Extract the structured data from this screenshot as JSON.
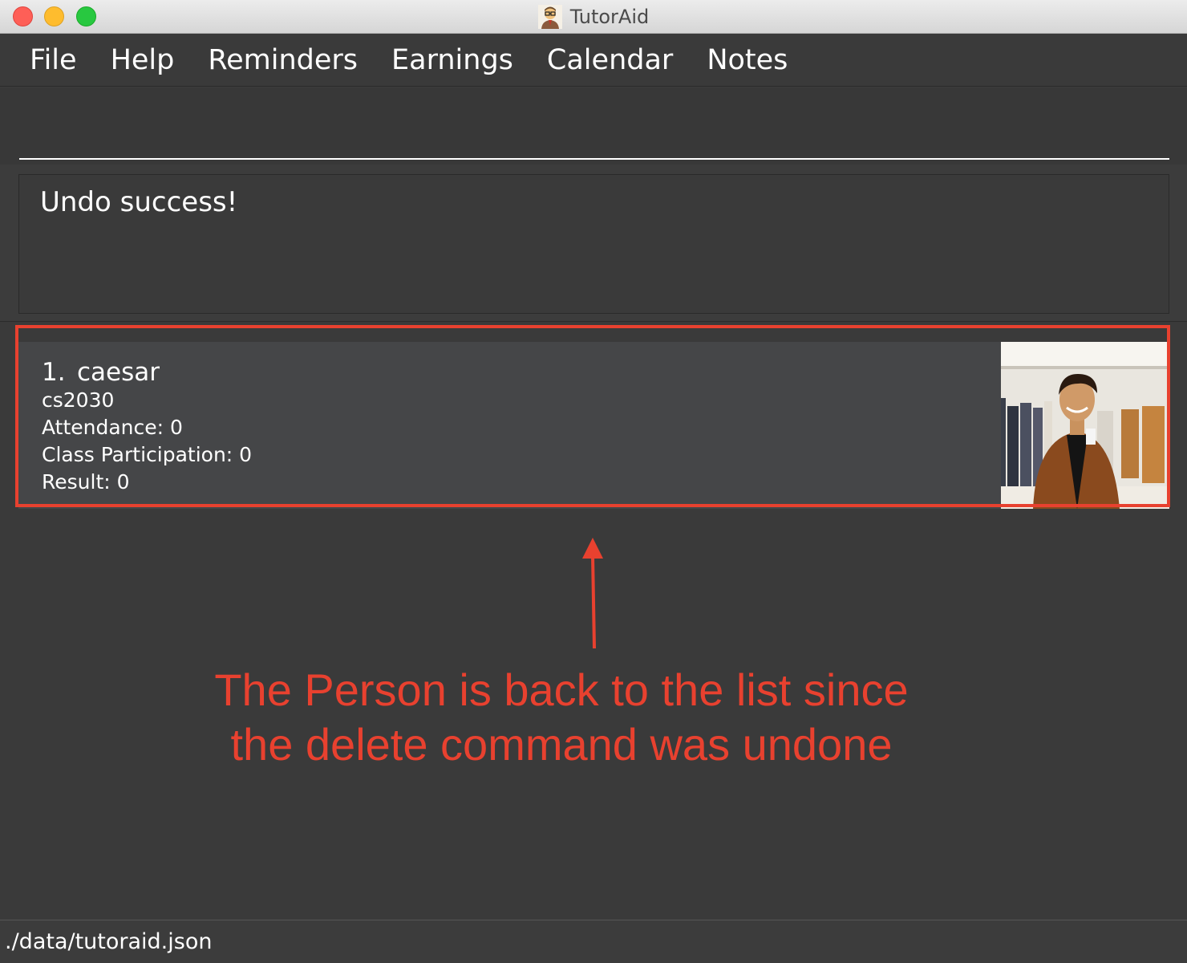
{
  "window": {
    "title": "TutorAid"
  },
  "menu": {
    "items": [
      "File",
      "Help",
      "Reminders",
      "Earnings",
      "Calendar",
      "Notes"
    ]
  },
  "command": {
    "value": ""
  },
  "result": {
    "message": "Undo success!"
  },
  "persons": [
    {
      "index": "1.",
      "name": "caesar",
      "module": "cs2030",
      "attendance": "Attendance: 0",
      "participation": "Class Participation: 0",
      "result": "Result: 0"
    }
  ],
  "annotation": {
    "line1": "The Person is back to the list since",
    "line2": "the delete command was undone",
    "color": "#e8412f"
  },
  "status": {
    "path": "./data/tutoraid.json"
  },
  "colors": {
    "background": "#3c3c3c",
    "card": "#454648",
    "close": "#fe5f57",
    "minimize": "#febc2e",
    "maximize": "#28c840"
  }
}
